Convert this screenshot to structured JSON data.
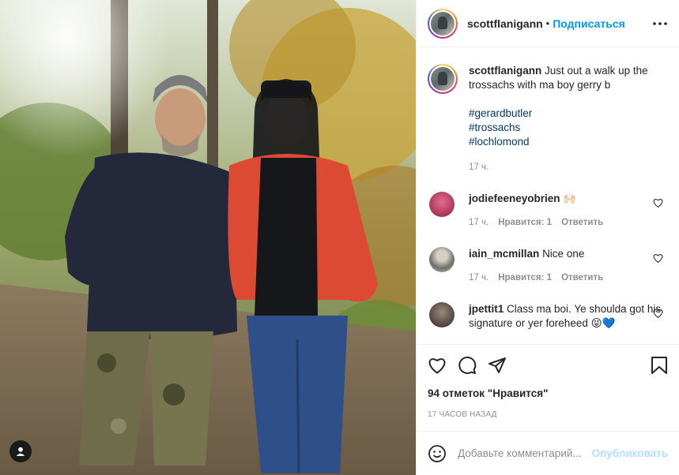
{
  "post": {
    "username": "scottflanigann",
    "follow_label": "Подписаться",
    "separator": "•"
  },
  "caption": {
    "username": "scottflanigann",
    "text": "Just out a walk up the trossachs with ma boy gerry b",
    "hashtags": [
      "#gerardbutler",
      "#trossachs",
      "#lochlomond"
    ],
    "time": "17 ч."
  },
  "comments": [
    {
      "username": "jodiefeeneyobrien",
      "text": "🙌🏻",
      "time": "17 ч.",
      "likes": "Нравится: 1",
      "reply": "Ответить",
      "avatar_color": "#b2345e"
    },
    {
      "username": "iain_mcmillan",
      "text": "Nice one",
      "time": "17 ч.",
      "likes": "Нравится: 1",
      "reply": "Ответить",
      "avatar_color": "#8e8a7f"
    },
    {
      "username": "jpettit1",
      "text": "Class ma boi. Ye shoulda got his signature or yer foreheed 😝💙",
      "time": "",
      "likes": "",
      "reply": "",
      "avatar_color": "#4a3e37"
    }
  ],
  "actions": {
    "likes_text": "94 отметок \"Нравится\"",
    "posted_ago": "17 ЧАСОВ НАЗАД"
  },
  "add_comment": {
    "placeholder": "Добавьте комментарий...",
    "publish_label": "Опубликовать"
  },
  "icons": [
    "tag-user-icon",
    "more-icon",
    "heart-icon",
    "comment-icon",
    "share-icon",
    "bookmark-icon",
    "emoji-icon"
  ]
}
